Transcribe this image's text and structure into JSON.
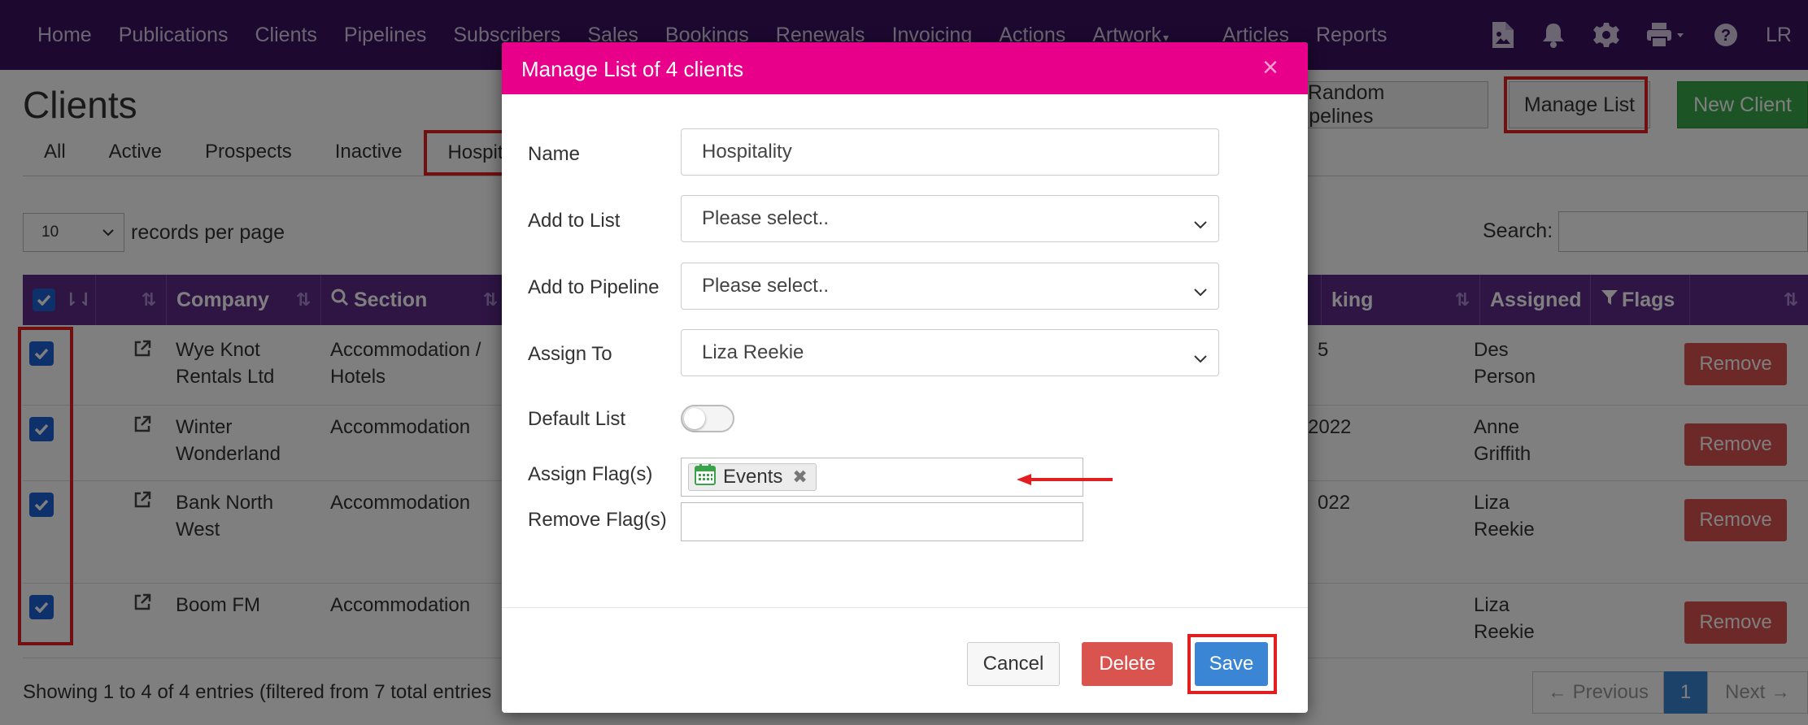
{
  "nav": {
    "links": [
      "Home",
      "Publications",
      "Clients",
      "Pipelines",
      "Subscribers",
      "Sales",
      "Bookings",
      "Renewals",
      "Invoicing",
      "Actions",
      "Artwork",
      "Articles",
      "Reports"
    ],
    "user_initials": "LR"
  },
  "page": {
    "title": "Clients",
    "tabs": [
      "All",
      "Active",
      "Prospects",
      "Inactive",
      "Hospitality"
    ],
    "random_pipelines_label": "e Random Pipelines",
    "manage_list_label": "Manage List",
    "new_client_label": "New Client",
    "per_page_value": "10",
    "per_page_label": "records per page",
    "search_label": "Search:"
  },
  "table": {
    "headers": {
      "company": "Company",
      "section": "Section",
      "booking": "king",
      "assigned": "Assigned",
      "flags": "Flags"
    },
    "rows": [
      {
        "company": [
          "Wye Knot",
          "Rentals Ltd"
        ],
        "section": [
          "Accommodation /",
          "Hotels"
        ],
        "booking": "5",
        "assigned": [
          "Des",
          "Person"
        ]
      },
      {
        "company": [
          "Winter",
          "Wonderland"
        ],
        "section": [
          "Accommodation",
          ""
        ],
        "booking": "2022",
        "assigned": [
          "Anne",
          "Griffith"
        ]
      },
      {
        "company": [
          "Bank North",
          "West"
        ],
        "section": [
          "Accommodation",
          ""
        ],
        "booking": "022",
        "assigned": [
          "Liza",
          "Reekie"
        ]
      },
      {
        "company": [
          "Boom FM",
          ""
        ],
        "section": [
          "Accommodation",
          ""
        ],
        "booking": "",
        "assigned": [
          "Liza",
          "Reekie"
        ]
      }
    ],
    "remove_label": "Remove",
    "showing_text": "Showing 1 to 4 of 4 entries (filtered from 7 total entries",
    "pager": {
      "previous": "← Previous",
      "current": "1",
      "next": "Next →"
    }
  },
  "modal": {
    "title": "Manage List of 4 clients",
    "name_label": "Name",
    "name_value": "Hospitality",
    "add_list_label": "Add to List",
    "add_list_value": "Please select..",
    "add_pipeline_label": "Add to Pipeline",
    "add_pipeline_value": "Please select..",
    "assign_to_label": "Assign To",
    "assign_to_value": "Liza Reekie",
    "default_list_label": "Default List",
    "assign_flags_label": "Assign Flag(s)",
    "assign_flag_tag": "Events",
    "remove_flags_label": "Remove Flag(s)",
    "cancel_label": "Cancel",
    "delete_label": "Delete",
    "save_label": "Save"
  },
  "colors": {
    "nav_bg": "#3a1060",
    "table_header_bg": "#5c2a88",
    "modal_header_bg": "#e8008a",
    "remove_red": "#d9534f",
    "save_blue": "#3a85d4",
    "new_client_green": "#38a84a",
    "highlight_red": "#e02020"
  }
}
